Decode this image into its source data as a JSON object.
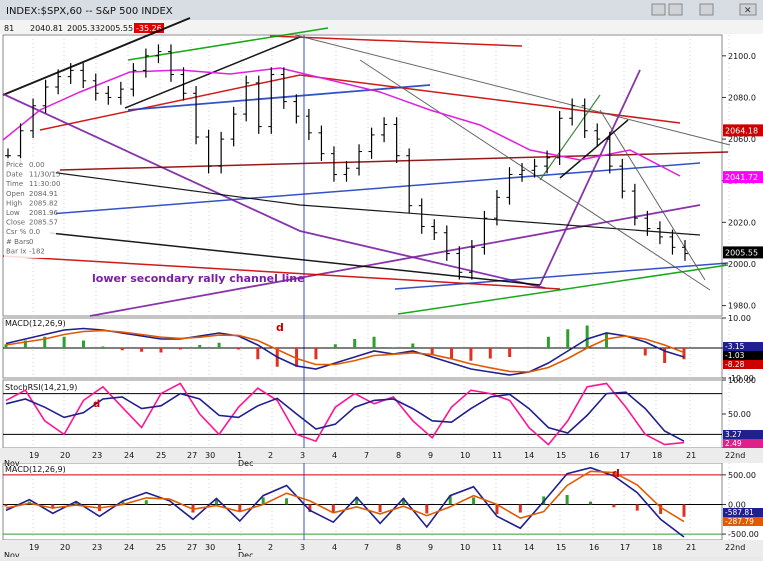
{
  "window": {
    "title": "INDEX:$SPX,60 -- S&P 500 INDEX",
    "ohlc_strip": [
      "81",
      "2040.81",
      "2005.33",
      "2005.55",
      "-35.26"
    ],
    "controls": [
      "minimize",
      "restore",
      "maximize",
      "close"
    ]
  },
  "data_window": {
    "rows": [
      {
        "label": "Price",
        "value": "0.00"
      },
      {
        "label": "Date",
        "value": "11/30/15"
      },
      {
        "label": "Time",
        "value": "11:30:00"
      },
      {
        "label": "Open",
        "value": "2084.91"
      },
      {
        "label": "High",
        "value": "2085.82"
      },
      {
        "label": "Low",
        "value": "2081.96"
      },
      {
        "label": "Close",
        "value": "2085.57"
      },
      {
        "label": "Csr %",
        "value": "0.0"
      },
      {
        "label": "# Bars",
        "value": "0"
      },
      {
        "label": "Bar Ix",
        "value": "-182"
      }
    ]
  },
  "annotations": {
    "channel_note": "lower secondary rally channel line",
    "divergence_marker": "d"
  },
  "x_axis": {
    "labels": [
      "19",
      "20",
      "23",
      "24",
      "25",
      "27",
      "30",
      "1",
      "2",
      "3",
      "4",
      "7",
      "8",
      "9",
      "10",
      "11",
      "14",
      "15",
      "16",
      "17",
      "18",
      "21",
      "22nd"
    ],
    "month_labels": [
      "Nov",
      "Dec"
    ]
  },
  "chart_data": [
    {
      "panel": "price",
      "type": "ohlc",
      "title": "INDEX:$SPX,60 -- S&P 500 INDEX",
      "ylim": [
        1975,
        2110
      ],
      "y_ticks": [
        1980,
        2000,
        2020,
        2040,
        2060,
        2080,
        2100
      ],
      "x_sessions": [
        "Nov 19",
        "Nov 20",
        "Nov 23",
        "Nov 24",
        "Nov 25",
        "Nov 27",
        "Nov 30",
        "Dec 1",
        "Dec 2",
        "Dec 3",
        "Dec 4",
        "Dec 7",
        "Dec 8",
        "Dec 9",
        "Dec 10",
        "Dec 11",
        "Dec 14",
        "Dec 15",
        "Dec 16",
        "Dec 17",
        "Dec 18",
        "Dec 21"
      ],
      "closes": [
        2052,
        2064,
        2076,
        2085,
        2090,
        2093,
        2088,
        2082,
        2080,
        2084,
        2093,
        2100,
        2102,
        2091,
        2082,
        2061,
        2047,
        2060,
        2072,
        2087,
        2066,
        2091,
        2078,
        2071,
        2063,
        2053,
        2043,
        2046,
        2054,
        2062,
        2067,
        2052,
        2028,
        2018,
        2015,
        2005,
        1996,
        2008,
        2022,
        2032,
        2043,
        2045,
        2047,
        2051,
        2070,
        2076,
        2064,
        2060,
        2047,
        2035,
        2022,
        2017,
        2013,
        2008,
        2005
      ],
      "reference_levels": [
        {
          "label": "2064.18",
          "value": 2064.18,
          "color": "#cc0000"
        },
        {
          "label": "2041.72",
          "value": 2041.72,
          "color": "#ff00ff"
        },
        {
          "label": "2005.55",
          "value": 2005.55,
          "color": "#000000"
        }
      ]
    },
    {
      "panel": "macd_hourly",
      "type": "line",
      "label": "MACD(12,26,9)",
      "ylim": [
        -10,
        10
      ],
      "y_ticks": [
        10,
        0,
        -10
      ],
      "series": [
        {
          "name": "MACD(12,26,9)",
          "color": "#1f1f8f",
          "values": [
            1.5,
            3,
            4.5,
            6,
            6.5,
            6,
            5,
            4,
            3,
            3,
            4,
            5,
            4,
            1,
            -3,
            -6,
            -7,
            -5,
            -3,
            -1,
            -2,
            -1,
            -3,
            -5,
            -7,
            -8,
            -9,
            -8,
            -5,
            -1,
            3,
            5,
            4,
            2,
            -1,
            -3
          ]
        },
        {
          "name": "Signal",
          "color": "#e05a00",
          "values": [
            1,
            2,
            3,
            4.5,
            5.5,
            5.8,
            5.3,
            4.5,
            3.6,
            3.2,
            3.6,
            4.3,
            4.2,
            2.5,
            -0.5,
            -3.5,
            -5.5,
            -5.5,
            -4.2,
            -2.5,
            -2.1,
            -1.6,
            -2.2,
            -3.6,
            -5.3,
            -6.6,
            -7.8,
            -8,
            -6.5,
            -3.5,
            0,
            3,
            4,
            3,
            1,
            -1.5
          ]
        }
      ],
      "readouts": [
        "-3.15",
        "-1.03",
        "-8.28"
      ]
    },
    {
      "panel": "stochastic",
      "type": "line",
      "label": "StochRSI(14,21,9)",
      "ylim": [
        0,
        100
      ],
      "y_ticks": [
        100,
        50,
        0
      ],
      "series": [
        {
          "name": "%K",
          "color": "#ff1493",
          "values": [
            70,
            85,
            40,
            20,
            70,
            90,
            60,
            30,
            80,
            95,
            50,
            20,
            60,
            88,
            70,
            20,
            10,
            60,
            80,
            65,
            75,
            40,
            15,
            60,
            85,
            80,
            70,
            30,
            5,
            40,
            90,
            95,
            60,
            20,
            5,
            8
          ]
        },
        {
          "name": "%D",
          "color": "#1f1f8f",
          "values": [
            65,
            72,
            60,
            45,
            52,
            72,
            75,
            58,
            62,
            80,
            72,
            48,
            45,
            62,
            73,
            50,
            28,
            35,
            60,
            70,
            72,
            58,
            40,
            38,
            58,
            75,
            79,
            58,
            30,
            22,
            48,
            80,
            82,
            58,
            25,
            10
          ]
        }
      ],
      "readouts": [
        "3.27",
        "2.49"
      ]
    },
    {
      "panel": "macd_wide",
      "type": "line",
      "label": "MACD(12,26,9)",
      "ylim": [
        -600,
        700
      ],
      "y_ticks": [
        500,
        0,
        -500
      ],
      "series": [
        {
          "name": "MACD(12,26,9)",
          "color": "#1f1f8f",
          "values": [
            -100,
            80,
            -150,
            50,
            -200,
            60,
            200,
            60,
            -250,
            100,
            -280,
            150,
            320,
            -100,
            -300,
            120,
            -320,
            100,
            -380,
            150,
            300,
            -200,
            -400,
            50,
            520,
            620,
            480,
            200,
            -250,
            -550
          ]
        },
        {
          "name": "Signal",
          "color": "#e05a00",
          "values": [
            -60,
            20,
            -60,
            -10,
            -60,
            0,
            110,
            90,
            -80,
            -20,
            -120,
            0,
            190,
            60,
            -140,
            -40,
            -160,
            -30,
            -190,
            -40,
            150,
            0,
            -230,
            -120,
            320,
            560,
            540,
            330,
            -50,
            -290
          ]
        }
      ],
      "readouts": [
        "-587.81",
        "-287.79"
      ]
    }
  ]
}
